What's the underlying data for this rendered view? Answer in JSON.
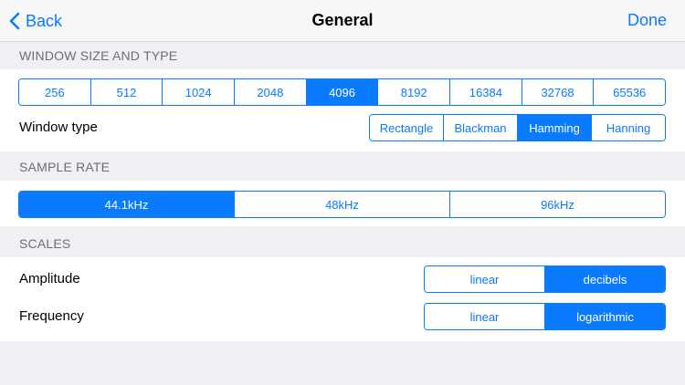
{
  "nav": {
    "back_label": "Back",
    "title": "General",
    "done_label": "Done"
  },
  "window_size": {
    "header": "WINDOW SIZE AND TYPE",
    "sizes": [
      "256",
      "512",
      "1024",
      "2048",
      "4096",
      "8192",
      "16384",
      "32768",
      "65536"
    ],
    "selected_size": "4096",
    "type_label": "Window type",
    "types": [
      "Rectangle",
      "Blackman",
      "Hamming",
      "Hanning"
    ],
    "selected_type": "Hamming"
  },
  "sample_rate": {
    "header": "SAMPLE RATE",
    "rates": [
      "44.1kHz",
      "48kHz",
      "96kHz"
    ],
    "selected_rate": "44.1kHz"
  },
  "scales": {
    "header": "SCALES",
    "amplitude_label": "Amplitude",
    "amplitude_options": [
      "linear",
      "decibels"
    ],
    "amplitude_selected": "decibels",
    "frequency_label": "Frequency",
    "frequency_options": [
      "linear",
      "logarithmic"
    ],
    "frequency_selected": "logarithmic"
  },
  "colors": {
    "accent": "#0a7aff",
    "background": "#efeff4"
  }
}
